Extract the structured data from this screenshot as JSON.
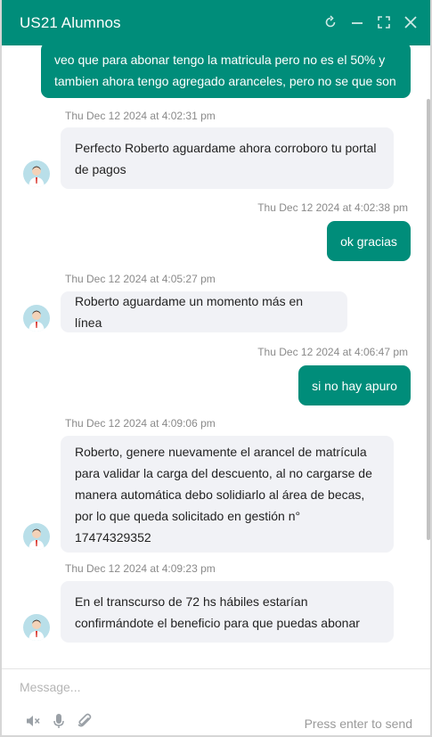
{
  "header": {
    "title": "US21 Alumnos",
    "controls": [
      "refresh-icon",
      "minimize-icon",
      "expand-icon",
      "close-icon"
    ]
  },
  "conversation": [
    {
      "side": "out",
      "lines": [
        "veo que para abonar tengo la matricula pero no es el 50% y",
        "tambien ahora tengo agregado aranceles, pero no se que son"
      ]
    },
    {
      "side": "in",
      "timestamp": "Thu Dec 12 2024 at 4:02:31 pm",
      "lines": [
        "Perfecto Roberto aguardame ahora corroboro tu portal",
        "de pagos"
      ]
    },
    {
      "side": "out",
      "timestamp": "Thu Dec 12 2024 at 4:02:38 pm",
      "lines": [
        "ok gracias"
      ]
    },
    {
      "side": "in",
      "timestamp": "Thu Dec 12 2024 at 4:05:27 pm",
      "lines": [
        "Roberto aguardame un momento más en línea"
      ]
    },
    {
      "side": "out",
      "timestamp": "Thu Dec 12 2024 at 4:06:47 pm",
      "lines": [
        "si no hay apuro"
      ]
    },
    {
      "side": "in",
      "timestamp": "Thu Dec 12 2024 at 4:09:06 pm",
      "lines": [
        "Roberto, genere nuevamente el arancel de matrícula",
        "para validar la carga del descuento, al no cargarse de",
        "manera automática debo solidiarlo al área de becas,",
        "por lo que queda solicitado en gestión n°",
        "17474329352"
      ]
    },
    {
      "side": "in",
      "timestamp": "Thu Dec 12 2024 at 4:09:23 pm",
      "lines": [
        "En el transcurso de 72 hs hábiles estarían",
        "confirmándote el beneficio para que puedas abonar"
      ]
    }
  ],
  "composer": {
    "placeholder": "Message...",
    "hint": "Press enter to send",
    "tools": [
      "mute-icon",
      "microphone-icon",
      "attachment-icon"
    ]
  },
  "colors": {
    "brand": "#008d7a",
    "incoming_bubble": "#f1f2f6",
    "timestamp": "#8a8a8a"
  }
}
